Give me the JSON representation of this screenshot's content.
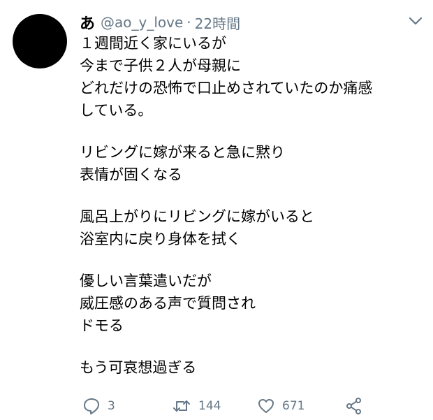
{
  "tweet": {
    "display_name": "あ",
    "handle": "@ao_y_love",
    "separator": "·",
    "time": "22時間",
    "lines": [
      "１週間近く家にいるが",
      "今まで子供２人が母親に",
      "どれだけの恐怖で口止めされていたのか痛感",
      "している。",
      "",
      "リビングに嫁が来ると急に黙り",
      "表情が固くなる",
      "",
      "風呂上がりにリビングに嫁がいると",
      "浴室内に戻り身体を拭く",
      "",
      "優しい言葉遣いだが",
      "威圧感のある声で質問され",
      "ドモる",
      "",
      "もう可哀想過ぎる"
    ],
    "actions": {
      "reply_count": "3",
      "retweet_count": "144",
      "like_count": "671"
    }
  },
  "icons": {
    "avatar": "avatar",
    "caret": "chevron-down-icon",
    "reply": "reply-icon",
    "retweet": "retweet-icon",
    "like": "heart-icon",
    "share": "share-icon"
  },
  "colors": {
    "text": "#000000",
    "secondary": "#657786",
    "avatar": "#000000",
    "background": "#ffffff"
  }
}
